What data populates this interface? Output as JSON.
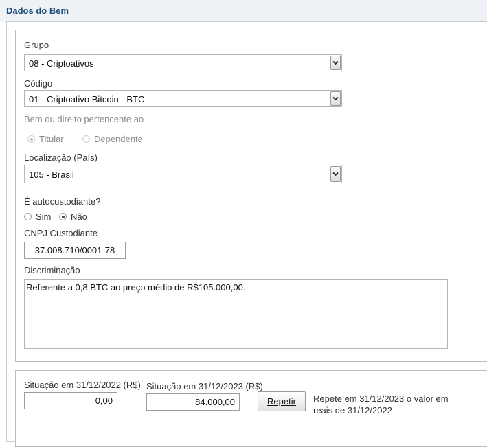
{
  "page": {
    "title": "Dados do Bem"
  },
  "grupo": {
    "label": "Grupo",
    "value": "08 - Criptoativos"
  },
  "codigo": {
    "label": "Código",
    "value": "01 - Criptoativo Bitcoin - BTC"
  },
  "pertencente": {
    "label": "Bem ou direito pertencente ao",
    "options": [
      {
        "label": "Titular",
        "selected": true
      },
      {
        "label": "Dependente",
        "selected": false
      }
    ]
  },
  "localizacao": {
    "label": "Localização (País)",
    "value": "105 - Brasil"
  },
  "autocustodiante": {
    "label": "É autocustodiante?",
    "options": [
      {
        "label": "Sim",
        "selected": false
      },
      {
        "label": "Não",
        "selected": true
      }
    ]
  },
  "cnpj": {
    "label": "CNPJ Custodiante",
    "value": "37.008.710/0001-78"
  },
  "discriminacao": {
    "label": "Discriminação",
    "value": "Referente a 0,8 BTC ao preço médio de R$105.000,00."
  },
  "situacao2022": {
    "label": "Situação em 31/12/2022 (R$)",
    "value": "0,00"
  },
  "situacao2023": {
    "label": "Situação em 31/12/2023 (R$)",
    "value": "84.000,00"
  },
  "repetir": {
    "label": "Repetir"
  },
  "repete_note": "Repete em 31/12/2023 o valor em reais de 31/12/2022"
}
